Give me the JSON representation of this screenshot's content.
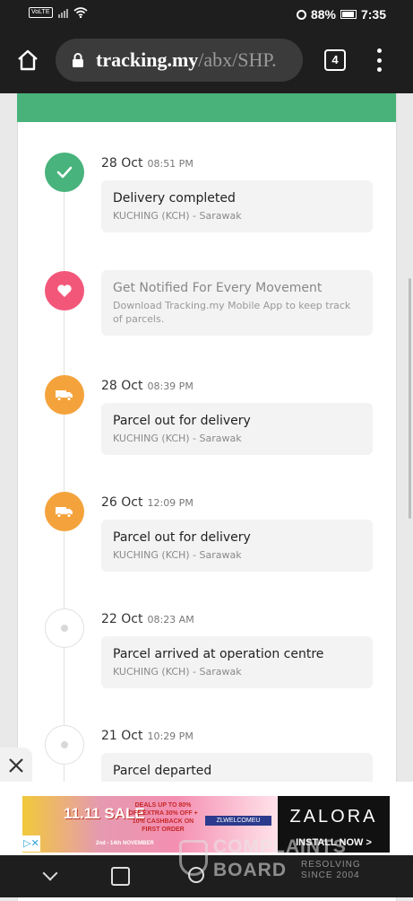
{
  "status_bar": {
    "carrier_badge": "VoLTE",
    "battery": "88%",
    "time": "7:35"
  },
  "browser": {
    "url_host": "tracking.my",
    "url_path": "/abx/SHP.",
    "tab_count": "4"
  },
  "events": [
    {
      "date": "28 Oct",
      "time": "08:51 PM",
      "status": "Delivery completed",
      "location": "KUCHING (KCH) - Sarawak",
      "icon": "check-icon",
      "color": "#48b37c"
    },
    {
      "status": "Get Notified For Every Movement",
      "location": "Download Tracking.my Mobile App to keep track of parcels.",
      "icon": "heart-icon",
      "color": "#f2577a"
    },
    {
      "date": "28 Oct",
      "time": "08:39 PM",
      "status": "Parcel out for delivery",
      "location": "KUCHING (KCH) - Sarawak",
      "icon": "truck-icon",
      "color": "#f4a33c"
    },
    {
      "date": "26 Oct",
      "time": "12:09 PM",
      "status": "Parcel out for delivery",
      "location": "KUCHING (KCH) - Sarawak",
      "icon": "truck-icon",
      "color": "#f4a33c"
    },
    {
      "date": "22 Oct",
      "time": "08:23 AM",
      "status": "Parcel arrived at operation centre",
      "location": "KUCHING (KCH) - Sarawak",
      "icon": "dot-icon"
    },
    {
      "date": "21 Oct",
      "time": "10:29 PM",
      "status": "Parcel departed",
      "icon": "dot-icon"
    }
  ],
  "ad": {
    "sale_text": "11.11 SALE",
    "deal_text": "DEALS UP TO 80% OFF EXTRA 30% OFF + 10% CASHBACK ON FIRST ORDER",
    "code_text": "ZLWELCOMEU",
    "dates_text": "2nd - 14th NOVEMBER",
    "brand": "ZALORA",
    "cta": "INSTALL NOW >",
    "close_symbol": "✕"
  },
  "watermark": {
    "line1": "COMPLAINTS",
    "line2": "BOARD",
    "tag1": "RESOLVING",
    "tag2": "SINCE 2004"
  }
}
